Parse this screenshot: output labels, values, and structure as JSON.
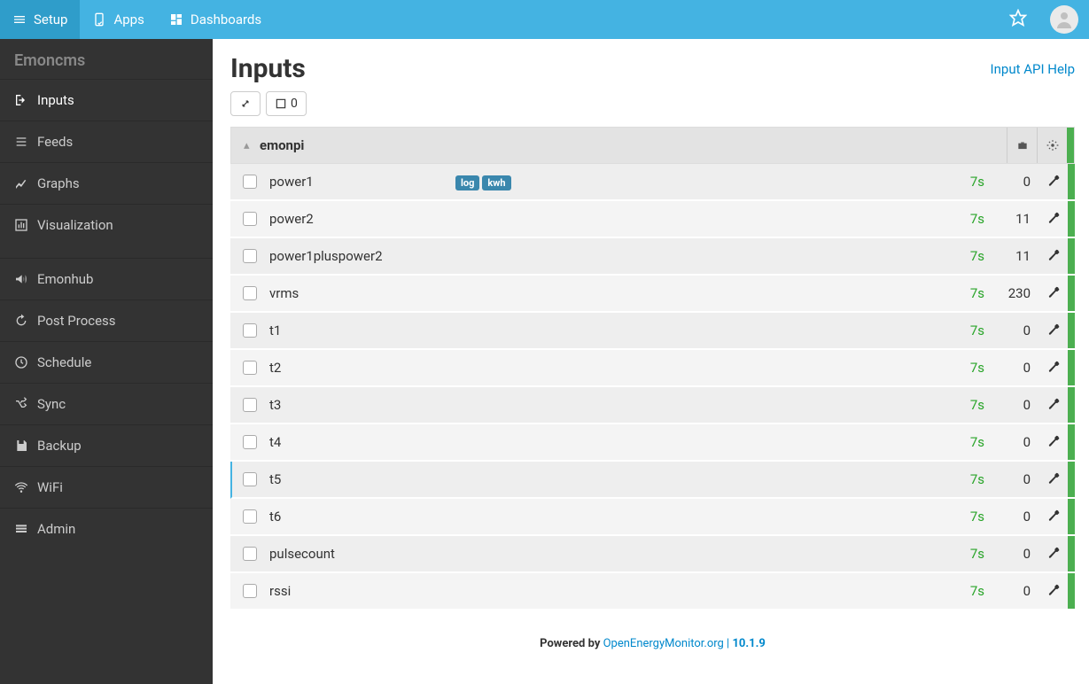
{
  "topbar": {
    "setup": "Setup",
    "apps": "Apps",
    "dashboards": "Dashboards"
  },
  "sidebar": {
    "brand": "Emoncms",
    "items": {
      "inputs": "Inputs",
      "feeds": "Feeds",
      "graphs": "Graphs",
      "visualization": "Visualization",
      "emonhub": "Emonhub",
      "postprocess": "Post Process",
      "schedule": "Schedule",
      "sync": "Sync",
      "backup": "Backup",
      "wifi": "WiFi",
      "admin": "Admin"
    }
  },
  "page": {
    "title": "Inputs",
    "api_link": "Input API Help",
    "select_count": "0"
  },
  "group": {
    "name": "emonpi"
  },
  "rows": [
    {
      "name": "power1",
      "tags": [
        "log",
        "kwh"
      ],
      "time": "7s",
      "value": "0"
    },
    {
      "name": "power2",
      "tags": [],
      "time": "7s",
      "value": "11"
    },
    {
      "name": "power1pluspower2",
      "tags": [],
      "time": "7s",
      "value": "11"
    },
    {
      "name": "vrms",
      "tags": [],
      "time": "7s",
      "value": "230"
    },
    {
      "name": "t1",
      "tags": [],
      "time": "7s",
      "value": "0"
    },
    {
      "name": "t2",
      "tags": [],
      "time": "7s",
      "value": "0"
    },
    {
      "name": "t3",
      "tags": [],
      "time": "7s",
      "value": "0"
    },
    {
      "name": "t4",
      "tags": [],
      "time": "7s",
      "value": "0"
    },
    {
      "name": "t5",
      "tags": [],
      "time": "7s",
      "value": "0",
      "selected": true
    },
    {
      "name": "t6",
      "tags": [],
      "time": "7s",
      "value": "0"
    },
    {
      "name": "pulsecount",
      "tags": [],
      "time": "7s",
      "value": "0"
    },
    {
      "name": "rssi",
      "tags": [],
      "time": "7s",
      "value": "0"
    }
  ],
  "footer": {
    "prefix": "Powered by ",
    "link": "OpenEnergyMonitor.org",
    "sep": " | ",
    "version": "10.1.9"
  }
}
